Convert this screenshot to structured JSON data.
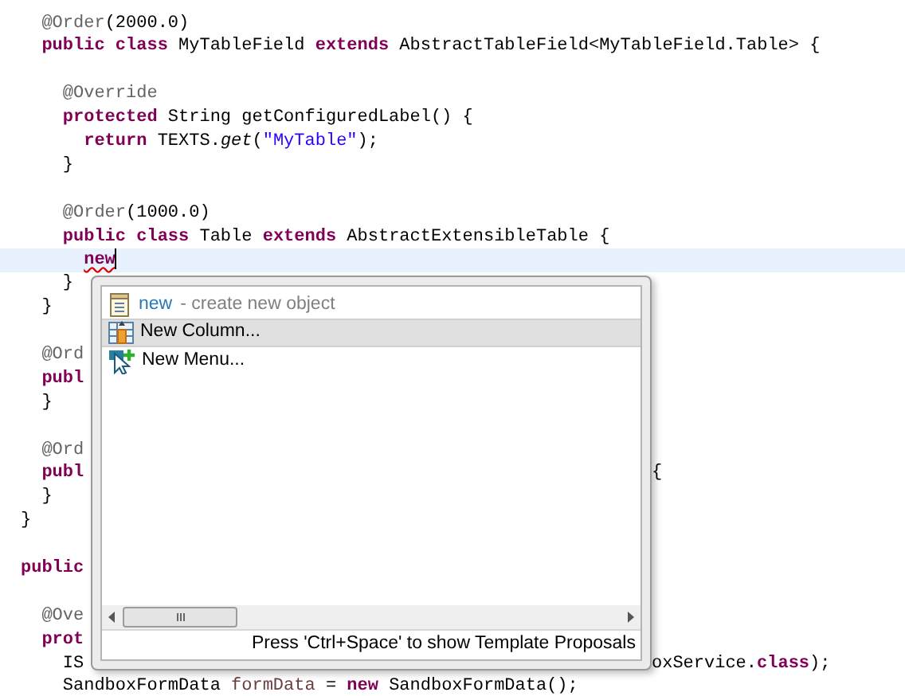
{
  "editor": {
    "lines": [
      {
        "kind": "code",
        "current": false,
        "tokens": [
          {
            "text": "  @Order",
            "kind": "annotation"
          },
          {
            "text": "(2000.0)",
            "kind": "plain"
          }
        ]
      },
      {
        "kind": "code",
        "current": false,
        "tokens": [
          {
            "text": "  public class",
            "kind": "keyword"
          },
          {
            "text": " MyTableField ",
            "kind": "plain"
          },
          {
            "text": "extends",
            "kind": "keyword"
          },
          {
            "text": " AbstractTableField<MyTableField.Table> {",
            "kind": "plain"
          }
        ]
      },
      {
        "kind": "blank"
      },
      {
        "kind": "code",
        "current": false,
        "tokens": [
          {
            "text": "    @Override",
            "kind": "annotation"
          }
        ]
      },
      {
        "kind": "code",
        "current": false,
        "tokens": [
          {
            "text": "    protected",
            "kind": "keyword"
          },
          {
            "text": " String getConfiguredLabel() {",
            "kind": "plain"
          }
        ]
      },
      {
        "kind": "code",
        "current": false,
        "tokens": [
          {
            "text": "      return",
            "kind": "keyword"
          },
          {
            "text": " TEXTS.",
            "kind": "plain"
          },
          {
            "text": "get",
            "kind": "static"
          },
          {
            "text": "(",
            "kind": "plain"
          },
          {
            "text": "\"MyTable\"",
            "kind": "string"
          },
          {
            "text": ");",
            "kind": "plain"
          }
        ]
      },
      {
        "kind": "code",
        "current": false,
        "tokens": [
          {
            "text": "    }",
            "kind": "plain"
          }
        ]
      },
      {
        "kind": "blank"
      },
      {
        "kind": "code",
        "current": false,
        "tokens": [
          {
            "text": "    @Order",
            "kind": "annotation"
          },
          {
            "text": "(1000.0)",
            "kind": "plain"
          }
        ]
      },
      {
        "kind": "code",
        "current": false,
        "tokens": [
          {
            "text": "    public class",
            "kind": "keyword"
          },
          {
            "text": " Table ",
            "kind": "plain"
          },
          {
            "text": "extends",
            "kind": "keyword"
          },
          {
            "text": " AbstractExtensibleTable {",
            "kind": "plain"
          }
        ]
      },
      {
        "kind": "code",
        "current": true,
        "tokens": [
          {
            "text": "      new",
            "kind": "error"
          }
        ]
      },
      {
        "kind": "code",
        "current": false,
        "tokens": [
          {
            "text": "    }",
            "kind": "plain"
          }
        ]
      },
      {
        "kind": "code",
        "current": false,
        "tokens": [
          {
            "text": "  }",
            "kind": "plain"
          }
        ]
      },
      {
        "kind": "blank"
      },
      {
        "kind": "code",
        "current": false,
        "tokens": [
          {
            "text": "  @Ord",
            "kind": "annotation"
          }
        ]
      },
      {
        "kind": "code",
        "current": false,
        "tokens": [
          {
            "text": "  publ",
            "kind": "keyword"
          }
        ]
      },
      {
        "kind": "code",
        "current": false,
        "tokens": [
          {
            "text": "  }",
            "kind": "plain"
          }
        ]
      },
      {
        "kind": "blank"
      },
      {
        "kind": "code",
        "current": false,
        "tokens": [
          {
            "text": "  @Ord",
            "kind": "annotation"
          }
        ]
      },
      {
        "kind": "code",
        "current": false,
        "tokens": [
          {
            "text": "  publ",
            "kind": "keyword"
          }
        ],
        "tail": [
          {
            "text": "{",
            "kind": "plain"
          }
        ]
      },
      {
        "kind": "code",
        "current": false,
        "tokens": [
          {
            "text": "  }",
            "kind": "plain"
          }
        ]
      },
      {
        "kind": "code",
        "current": false,
        "tokens": [
          {
            "text": "}",
            "kind": "plain"
          }
        ]
      },
      {
        "kind": "blank"
      },
      {
        "kind": "code",
        "current": false,
        "tokens": [
          {
            "text": "public",
            "kind": "keyword"
          }
        ]
      },
      {
        "kind": "blank"
      },
      {
        "kind": "code",
        "current": false,
        "tokens": [
          {
            "text": "  @Ove",
            "kind": "annotation"
          }
        ]
      },
      {
        "kind": "code",
        "current": false,
        "tokens": [
          {
            "text": "  prot",
            "kind": "keyword"
          }
        ]
      },
      {
        "kind": "code",
        "current": false,
        "tokens": [
          {
            "text": "    IS",
            "kind": "plain"
          }
        ],
        "tail": [
          {
            "text": "oxService.",
            "kind": "plain"
          },
          {
            "text": "class",
            "kind": "keyword"
          },
          {
            "text": ");",
            "kind": "plain"
          }
        ]
      },
      {
        "kind": "code",
        "current": false,
        "tokens": [
          {
            "text": "    SandboxFormData ",
            "kind": "plain"
          },
          {
            "text": "formData",
            "kind": "local"
          },
          {
            "text": " = ",
            "kind": "plain"
          },
          {
            "text": "new",
            "kind": "keyword"
          },
          {
            "text": " SandboxFormData();",
            "kind": "plain"
          }
        ]
      }
    ]
  },
  "popup": {
    "header": {
      "keyword": "new",
      "description": "- create new object"
    },
    "proposals": [
      {
        "label": "New Column...",
        "selected": true,
        "kind": "column"
      },
      {
        "label": "New Menu...",
        "selected": false,
        "kind": "menu"
      }
    ],
    "status": "Press 'Ctrl+Space' to show Template Proposals"
  }
}
